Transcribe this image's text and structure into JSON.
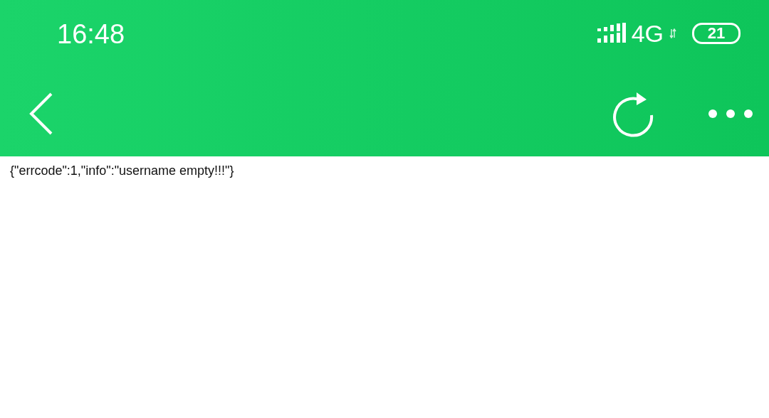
{
  "status_bar": {
    "time": "16:48",
    "network": "4G",
    "battery": "21"
  },
  "body": {
    "text": "{\"errcode\":1,\"info\":\"username empty!!!\"}"
  }
}
